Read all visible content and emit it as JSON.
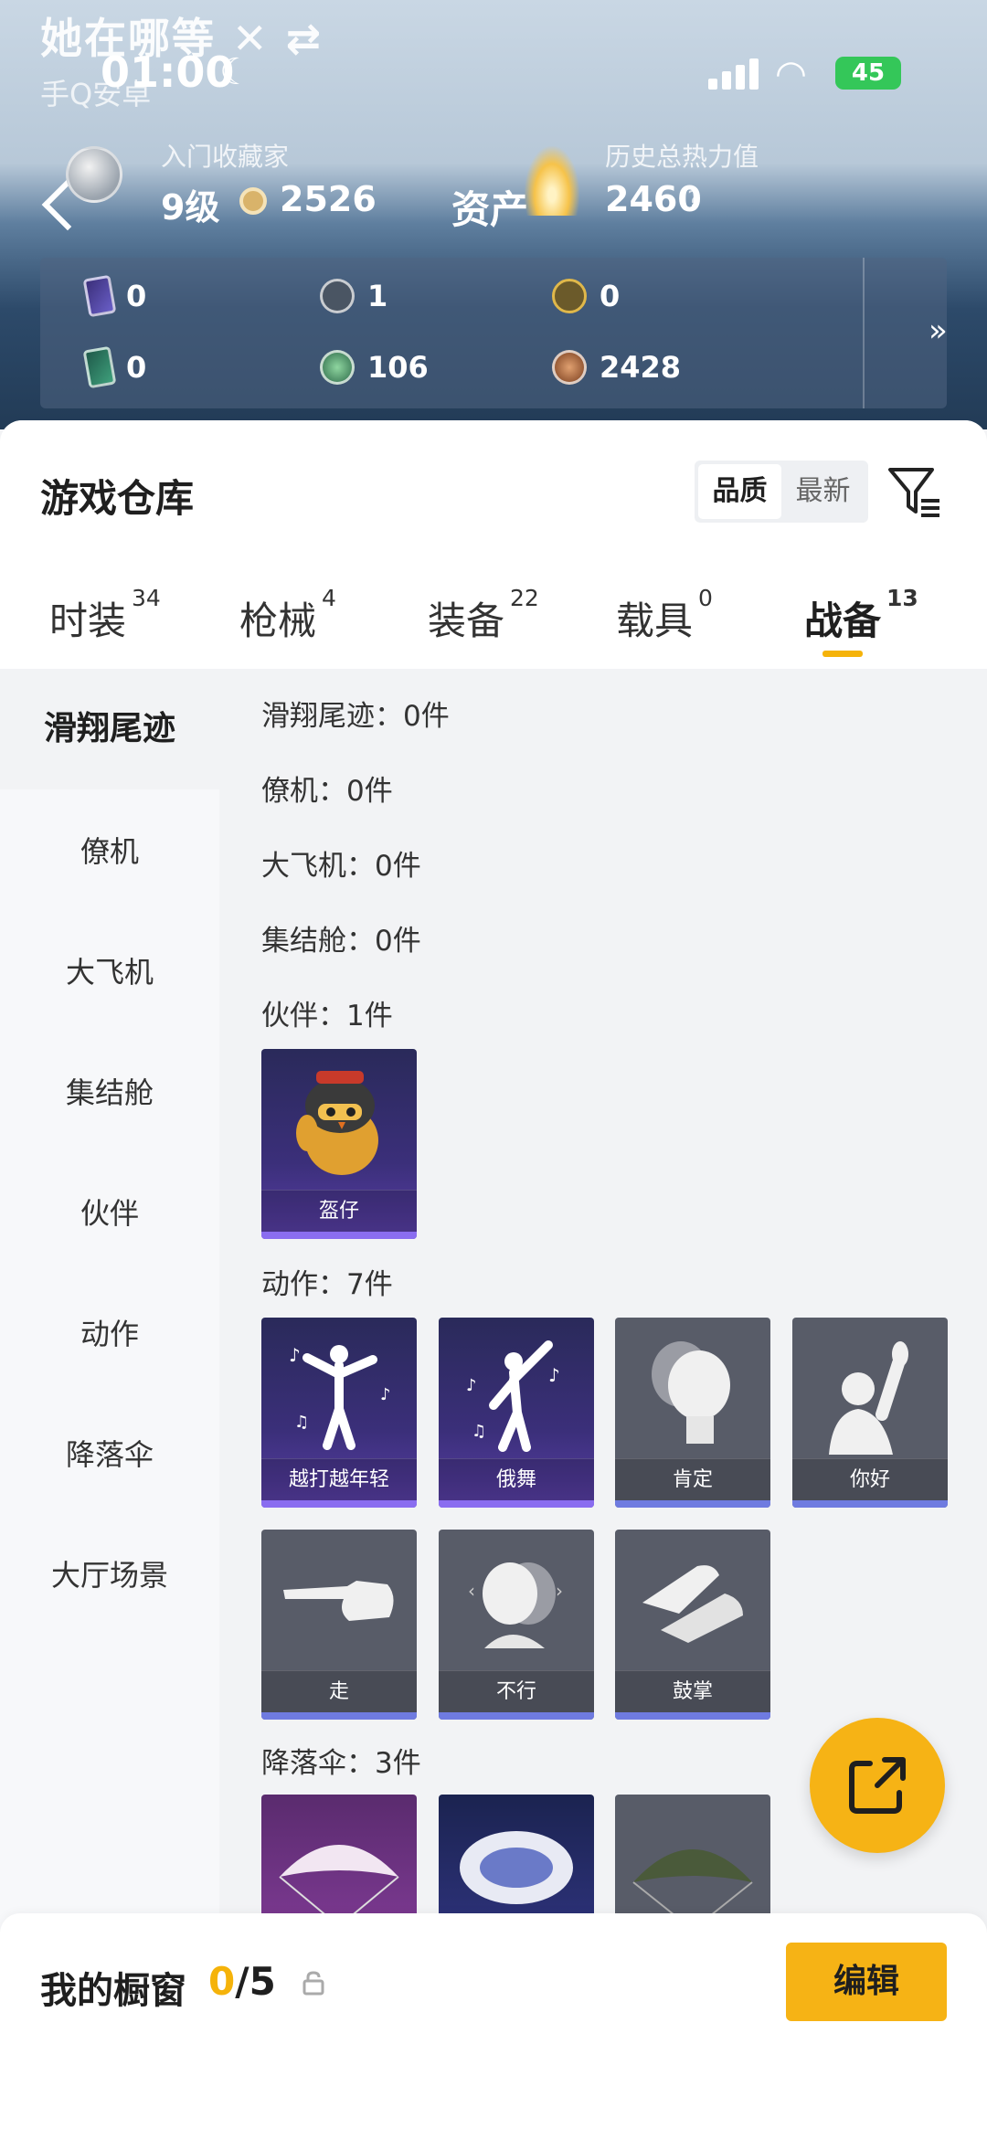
{
  "status_bar": {
    "chat_title": "她在哪等",
    "chat_sub": "手Q安卓",
    "time": "01:00",
    "battery": "45"
  },
  "profile": {
    "collector_label": "入门收藏家",
    "level": "9级",
    "coins": "2526",
    "asset_label": "资产",
    "heat_label": "历史总热力值",
    "heat_value": "2460",
    "help_icon": "?"
  },
  "resources": [
    {
      "icon": "purple-card-icon",
      "value": "0"
    },
    {
      "icon": "silver-s-coin-icon",
      "value": "1"
    },
    {
      "icon": "gold-a-coin-icon",
      "value": "0"
    },
    {
      "icon": "green-card-icon",
      "value": "0"
    },
    {
      "icon": "green-gem-icon",
      "value": "106"
    },
    {
      "icon": "bronze-coin-icon",
      "value": "2428"
    }
  ],
  "warehouse": {
    "title": "游戏仓库",
    "sort_quality": "品质",
    "sort_latest": "最新"
  },
  "tabs": [
    {
      "label": "时装",
      "count": "34"
    },
    {
      "label": "枪械",
      "count": "4"
    },
    {
      "label": "装备",
      "count": "22"
    },
    {
      "label": "载具",
      "count": "0"
    },
    {
      "label": "战备",
      "count": "13"
    }
  ],
  "side_nav": [
    "滑翔尾迹",
    "僚机",
    "大飞机",
    "集结舱",
    "伙伴",
    "动作",
    "降落伞",
    "大厅场景"
  ],
  "sections": {
    "glide": "滑翔尾迹：0件",
    "wingman": "僚机：0件",
    "plane": "大飞机：0件",
    "capsule": "集结舱：0件",
    "partner": "伙伴：1件",
    "emote": "动作：7件",
    "parachute": "降落伞：3件"
  },
  "partner_items": [
    "盔仔"
  ],
  "emote_items": [
    "越打越年轻",
    "俄舞",
    "肯定",
    "你好",
    "走",
    "不行",
    "鼓掌"
  ],
  "showcase": {
    "title": "我的橱窗",
    "count_num": "0",
    "count_total": "/5",
    "edit_label": "编辑"
  },
  "colors": {
    "accent": "#f6b315",
    "tab_underline": "#f5b30a"
  }
}
